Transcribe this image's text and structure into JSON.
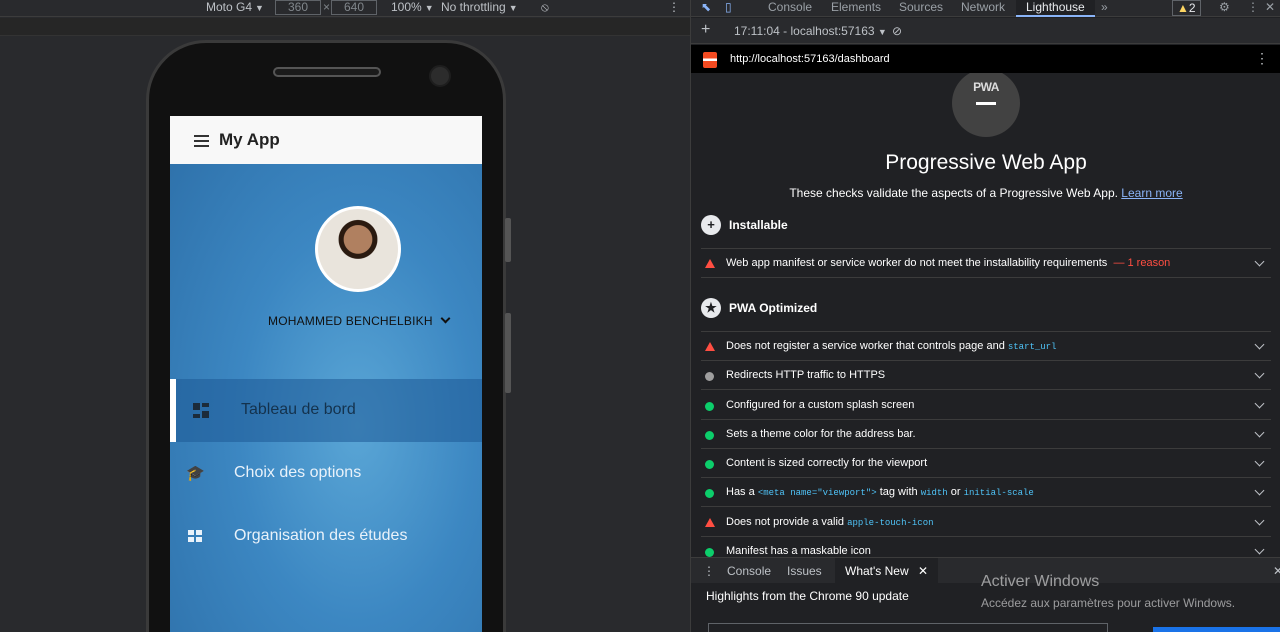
{
  "emulator": {
    "device": "Moto G4",
    "width": "360",
    "height": "640",
    "zoom": "100%",
    "throttling": "No throttling"
  },
  "app": {
    "title": "My App",
    "user_name": "MOHAMMED BENCHELBIKH",
    "nav": [
      {
        "label": "Tableau de bord",
        "icon": "dashboard-icon",
        "active": true
      },
      {
        "label": "Choix des options",
        "icon": "graduation-cap-icon",
        "active": false
      },
      {
        "label": "Organisation des études",
        "icon": "apps-grid-icon",
        "active": false
      }
    ]
  },
  "devtools": {
    "tabs": [
      "Console",
      "Elements",
      "Sources",
      "Network",
      "Lighthouse"
    ],
    "active_tab": "Lighthouse",
    "warning_count": "2",
    "report_selector": "17:11:04 - localhost:57163",
    "url": "http://localhost:57163/dashboard"
  },
  "report": {
    "badge": "PWA",
    "title": "Progressive Web App",
    "description": "These checks validate the aspects of a Progressive Web App.",
    "learn_more": "Learn more",
    "groups": [
      {
        "title": "Installable",
        "icon": "plus-icon",
        "audits": [
          {
            "status": "fail",
            "text": "Web app manifest or service worker do not meet the installability requirements",
            "suffix": "— 1 reason"
          }
        ]
      },
      {
        "title": "PWA Optimized",
        "icon": "star-icon",
        "audits": [
          {
            "status": "fail",
            "text": "Does not register a service worker that controls page and",
            "code": "start_url"
          },
          {
            "status": "na",
            "text": "Redirects HTTP traffic to HTTPS"
          },
          {
            "status": "pass",
            "text": "Configured for a custom splash screen"
          },
          {
            "status": "pass",
            "text": "Sets a theme color for the address bar."
          },
          {
            "status": "pass",
            "text": "Content is sized correctly for the viewport"
          },
          {
            "status": "pass",
            "text": "Has a",
            "code": "<meta name=\"viewport\">",
            "text2": "tag with",
            "code2": "width",
            "text3": "or",
            "code3": "initial-scale"
          },
          {
            "status": "fail",
            "text": "Does not provide a valid",
            "code": "apple-touch-icon"
          },
          {
            "status": "pass",
            "text": "Manifest has a maskable icon"
          }
        ]
      }
    ]
  },
  "drawer": {
    "tabs": [
      "Console",
      "Issues",
      "What's New"
    ],
    "active_tab": "What's New",
    "headline": "Highlights from the Chrome 90 update"
  },
  "watermark": {
    "title": "Activer Windows",
    "subtitle": "Accédez aux paramètres pour activer Windows."
  },
  "colors": {
    "pass": "#0cce6b",
    "fail": "#ff4e42",
    "na": "#9e9e9e",
    "link": "#8ab4f8",
    "app_bg": "#3c87c2"
  }
}
